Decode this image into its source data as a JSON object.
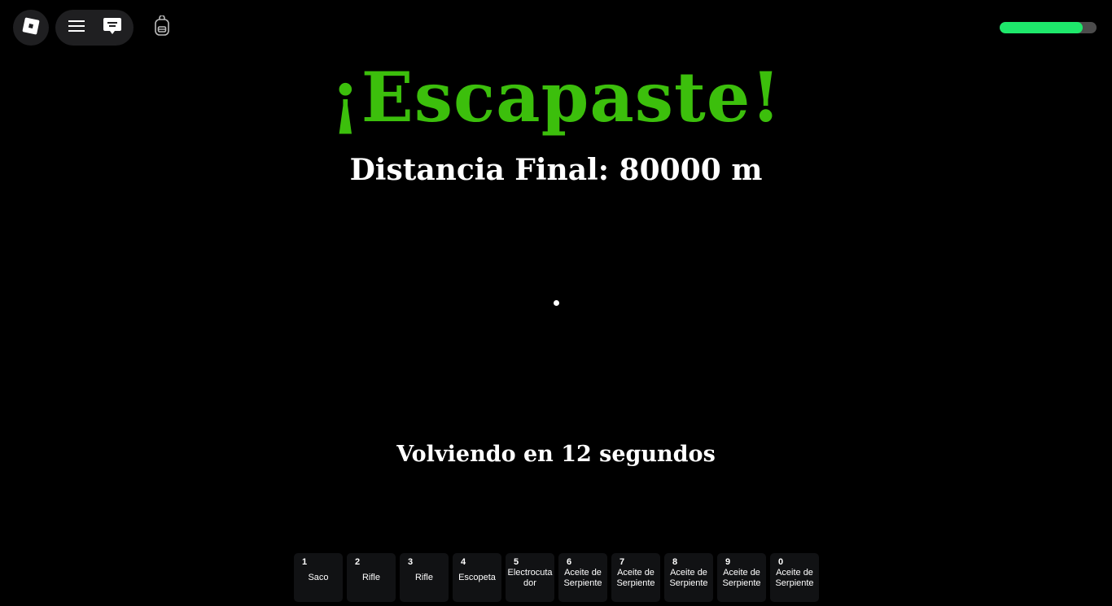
{
  "topbar": {
    "roblox_icon": "roblox-logo-icon",
    "menu_icon": "hamburger-menu-icon",
    "chat_icon": "chat-icon",
    "backpack_icon": "backpack-icon"
  },
  "health": {
    "fraction": 0.86,
    "fill_color": "#1ee86b",
    "track_color": "#4c4c4c"
  },
  "game": {
    "title": "¡Escapaste!",
    "title_color": "#3cbf0c",
    "distance": "Distancia Final: 80000 m",
    "countdown": "Volviendo en 12 segundos"
  },
  "hotbar": [
    {
      "key": "1",
      "label": "Saco"
    },
    {
      "key": "2",
      "label": "Rifle"
    },
    {
      "key": "3",
      "label": "Rifle"
    },
    {
      "key": "4",
      "label": "Escopeta"
    },
    {
      "key": "5",
      "label": "Electrocutador"
    },
    {
      "key": "6",
      "label": "Aceite de Serpiente"
    },
    {
      "key": "7",
      "label": "Aceite de Serpiente"
    },
    {
      "key": "8",
      "label": "Aceite de Serpiente"
    },
    {
      "key": "9",
      "label": "Aceite de Serpiente"
    },
    {
      "key": "0",
      "label": "Aceite de Serpiente"
    }
  ]
}
